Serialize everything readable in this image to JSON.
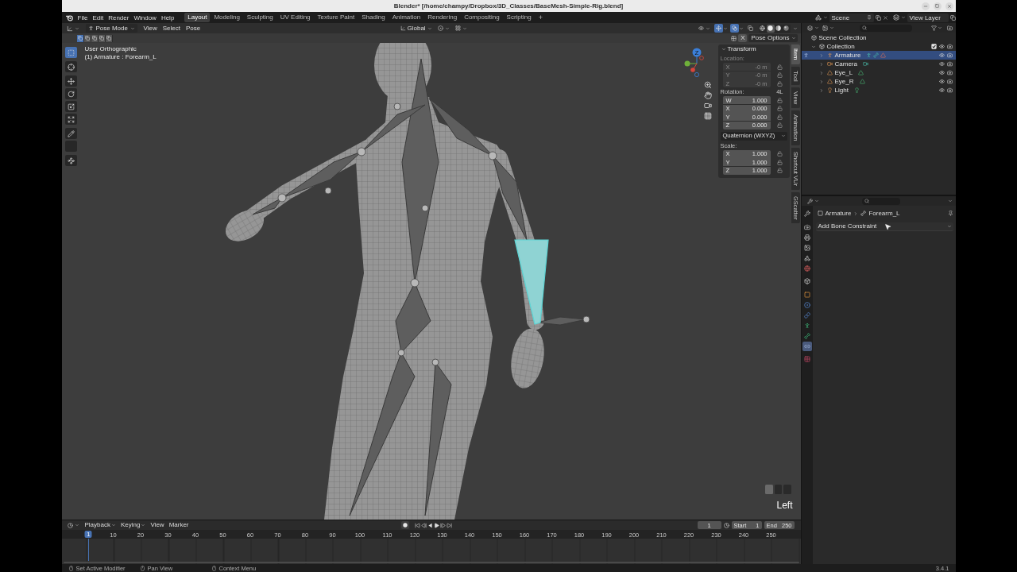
{
  "window": {
    "title": "Blender* [/home/champy/Dropbox/3D_Classes/BaseMesh-Simple-Rig.blend]"
  },
  "menu_bar": [
    "File",
    "Edit",
    "Render",
    "Window",
    "Help"
  ],
  "workspaces": [
    {
      "label": "Layout",
      "selected": true
    },
    {
      "label": "Modeling",
      "selected": false
    },
    {
      "label": "Sculpting",
      "selected": false
    },
    {
      "label": "UV Editing",
      "selected": false
    },
    {
      "label": "Texture Paint",
      "selected": false
    },
    {
      "label": "Shading",
      "selected": false
    },
    {
      "label": "Animation",
      "selected": false
    },
    {
      "label": "Rendering",
      "selected": false
    },
    {
      "label": "Compositing",
      "selected": false
    },
    {
      "label": "Scripting",
      "selected": false
    }
  ],
  "add_workspace": "+",
  "scene": "Scene",
  "view_layer": "View Layer",
  "viewport": {
    "mode": "Pose Mode",
    "menus": [
      "View",
      "Select",
      "Pose"
    ],
    "orientation": "Global",
    "gizmos": {
      "on": true
    },
    "overlays": {
      "on": true
    },
    "xray": {
      "on": false
    },
    "shading": [
      {
        "selected": false
      },
      {
        "selected": true
      },
      {
        "selected": false
      },
      {
        "selected": false
      }
    ],
    "select_modes": [
      {
        "selected": true
      },
      {
        "selected": false
      },
      {
        "selected": false
      },
      {
        "selected": false
      },
      {
        "selected": false
      }
    ],
    "pose_mirror": {
      "label": "X",
      "on": false
    },
    "pose_options": "Pose Options",
    "tools": [
      {
        "selected": true
      },
      {
        "selected": false
      },
      {
        "selected": false
      },
      {
        "selected": false
      },
      {
        "selected": false
      },
      {
        "selected": false
      },
      {
        "selected": false
      },
      {
        "selected": false
      },
      {
        "selected": false
      }
    ],
    "view_name": "User Orthographic",
    "active_item": "(1) Armature : Forearm_L",
    "gizmo_label": "Z",
    "pressed_key": "Left"
  },
  "sidebar": {
    "panel": {
      "title": "Transform",
      "expanded": true
    },
    "rows": [
      {
        "kind": "vector",
        "label": "Location:",
        "disabled": true,
        "fields": [
          {
            "axis": "X",
            "value": "-0 m"
          },
          {
            "axis": "Y",
            "value": "-0 m"
          },
          {
            "axis": "Z",
            "value": "-0 m"
          }
        ]
      },
      {
        "kind": "vector",
        "label": "Rotation:",
        "note": "4L",
        "disabled": false,
        "fields": [
          {
            "axis": "W",
            "value": "1.000"
          },
          {
            "axis": "X",
            "value": "0.000"
          },
          {
            "axis": "Y",
            "value": "0.000"
          },
          {
            "axis": "Z",
            "value": "0.000"
          }
        ]
      },
      {
        "kind": "dropdown",
        "value": "Quaternion (WXYZ)",
        "disabled": false
      },
      {
        "kind": "vector",
        "label": "Scale:",
        "disabled": false,
        "fields": [
          {
            "axis": "X",
            "value": "1.000"
          },
          {
            "axis": "Y",
            "value": "1.000"
          },
          {
            "axis": "Z",
            "value": "1.000"
          }
        ]
      }
    ],
    "tabs": [
      {
        "label": "Item",
        "selected": true
      },
      {
        "label": "Tool",
        "selected": false
      },
      {
        "label": "View",
        "selected": false
      },
      {
        "label": "Animation",
        "selected": false
      },
      {
        "label": "Shortcut VUr",
        "selected": false
      },
      {
        "label": "GScatter",
        "selected": false
      }
    ]
  },
  "outliner": {
    "tree": [
      {
        "name": "Scene Collection",
        "kind": "scene",
        "selected": false,
        "children": [
          {
            "name": "Collection",
            "kind": "collection",
            "expanded": true,
            "selected": false,
            "checked": true,
            "children": [
              {
                "name": "Armature",
                "kind": "armature",
                "expanded": false,
                "selected": true
              },
              {
                "name": "Camera",
                "kind": "camera",
                "expanded": false,
                "selected": false
              },
              {
                "name": "Eye_L",
                "kind": "mesh",
                "expanded": false,
                "selected": false
              },
              {
                "name": "Eye_R",
                "kind": "mesh",
                "expanded": false,
                "selected": false
              },
              {
                "name": "Light",
                "kind": "light",
                "expanded": false,
                "selected": false
              }
            ]
          }
        ]
      }
    ]
  },
  "properties": {
    "tabs": [
      {
        "selected": false
      },
      {
        "selected": false
      },
      {
        "selected": false
      },
      {
        "selected": false
      },
      {
        "selected": false
      },
      {
        "selected": false
      },
      {
        "selected": false
      },
      {
        "selected": false
      },
      {
        "selected": false
      },
      {
        "selected": false
      },
      {
        "selected": false
      },
      {
        "selected": false
      },
      {
        "selected": true
      },
      {
        "selected": false
      }
    ],
    "breadcrumb": [
      "Armature",
      "Forearm_L"
    ],
    "add_menu": "Add Bone Constraint"
  },
  "timeline": {
    "menus": [
      {
        "label": "Playback",
        "dropdown": true
      },
      {
        "label": "Keying",
        "dropdown": true
      },
      {
        "label": "View",
        "dropdown": false
      },
      {
        "label": "Marker",
        "dropdown": false
      }
    ],
    "auto_keying": {
      "on": false
    },
    "current_frame": "1",
    "start": {
      "label": "Start",
      "value": "1"
    },
    "end": {
      "label": "End",
      "value": "250"
    },
    "ruler": [
      "10",
      "20",
      "30",
      "40",
      "50",
      "60",
      "70",
      "80",
      "90",
      "100",
      "110",
      "120",
      "130",
      "140",
      "150",
      "160",
      "170",
      "180",
      "190",
      "200",
      "210",
      "220",
      "230",
      "240",
      "250"
    ],
    "playhead": "1"
  },
  "status_bar": {
    "hints": [
      "Set Active Modifier",
      "Pan View",
      "Context Menu"
    ],
    "version": "3.4.1"
  }
}
